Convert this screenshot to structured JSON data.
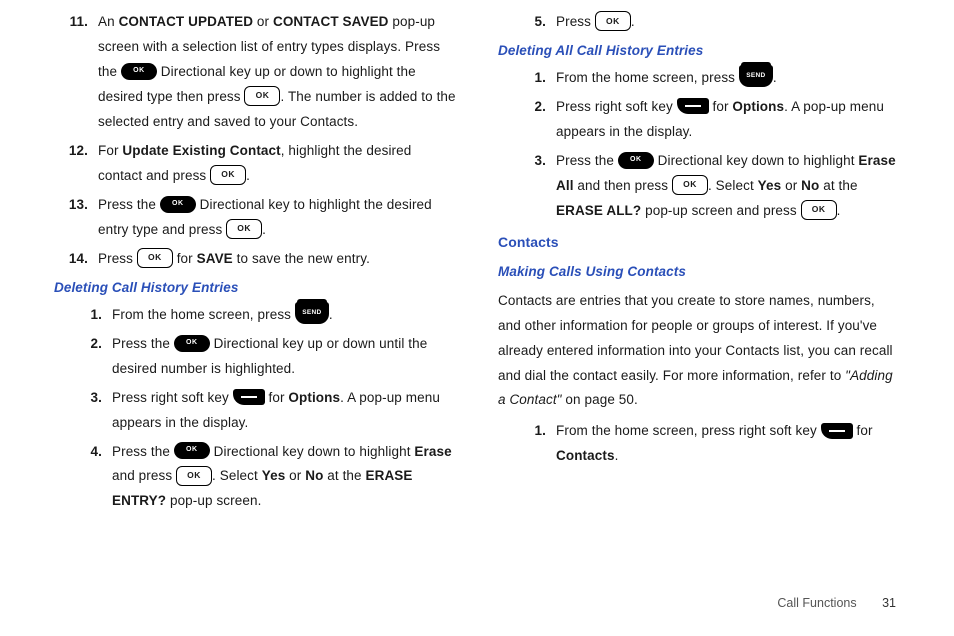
{
  "icons": {
    "ok": "OK",
    "okBlack": "OK",
    "send": "SEND"
  },
  "left": {
    "items11_14": [
      {
        "n": "11.",
        "p1a": "An ",
        "p1b": "CONTACT UPDATED",
        "p1c": " or ",
        "p1d": "CONTACT SAVED",
        "p1e": " pop-up screen with a selection list of entry types displays. Press the ",
        "p2a": " Directional key up or down to highlight the desired type then press ",
        "p2b": ". The number is added to the selected entry and saved to your Contacts."
      },
      {
        "n": "12.",
        "p1a": "For ",
        "p1b": "Update Existing Contact",
        "p1c": ", highlight the desired contact and press ",
        "p1d": "."
      },
      {
        "n": "13.",
        "p1a": "Press the ",
        "p1b": " Directional key to highlight the desired entry type and press ",
        "p1c": "."
      },
      {
        "n": "14.",
        "p1a": "Press ",
        "p1b": " for ",
        "p1c": "SAVE",
        "p1d": " to save the new entry."
      }
    ],
    "h3a": "Deleting Call History Entries",
    "del_items": [
      {
        "n": "1.",
        "a": "From the home screen, press ",
        "b": "."
      },
      {
        "n": "2.",
        "a": "Press the ",
        "b": " Directional key up or down until the desired number is highlighted."
      },
      {
        "n": "3.",
        "a": "Press right soft key ",
        "b": " for ",
        "c": "Options",
        "d": ". A pop-up menu appears in the display."
      },
      {
        "n": "4.",
        "a": "Press the ",
        "b": " Directional key down to highlight ",
        "c": "Erase",
        "d": " and press ",
        "e": ". Select ",
        "f": "Yes",
        "g": " or ",
        "h": "No",
        "i": " at the ",
        "j": "ERASE ENTRY?",
        "k": " pop-up screen."
      }
    ]
  },
  "right": {
    "item5": {
      "n": "5.",
      "a": "Press ",
      "b": "."
    },
    "h3b": "Deleting All Call History Entries",
    "delall_items": [
      {
        "n": "1.",
        "a": "From the home screen, press ",
        "b": "."
      },
      {
        "n": "2.",
        "a": "Press right soft key ",
        "b": " for ",
        "c": "Options",
        "d": ". A pop-up menu appears in the display."
      },
      {
        "n": "3.",
        "a": "Press the ",
        "b": " Directional key down to highlight ",
        "c": "Erase All",
        "d": " and then press ",
        "e": ". Select ",
        "f": "Yes",
        "g": " or ",
        "h": "No",
        "i": " at the ",
        "j": "ERASE ALL?",
        "k": " pop-up screen and press ",
        "l": "."
      }
    ],
    "h2": "Contacts",
    "h3c": "Making Calls Using Contacts",
    "para": {
      "a": "Contacts are entries that you create to store names, numbers, and other information for people or groups of interest. If you've already entered information into your Contacts list, you can recall and dial the contact easily. For more information, refer to ",
      "b": "\"Adding a Contact\"",
      "c": "  on page 50."
    },
    "item1": {
      "n": "1.",
      "a": "From the home screen, press right soft key ",
      "b": " for ",
      "c": "Contacts",
      "d": "."
    }
  },
  "footer": {
    "section": "Call Functions",
    "page": "31"
  }
}
